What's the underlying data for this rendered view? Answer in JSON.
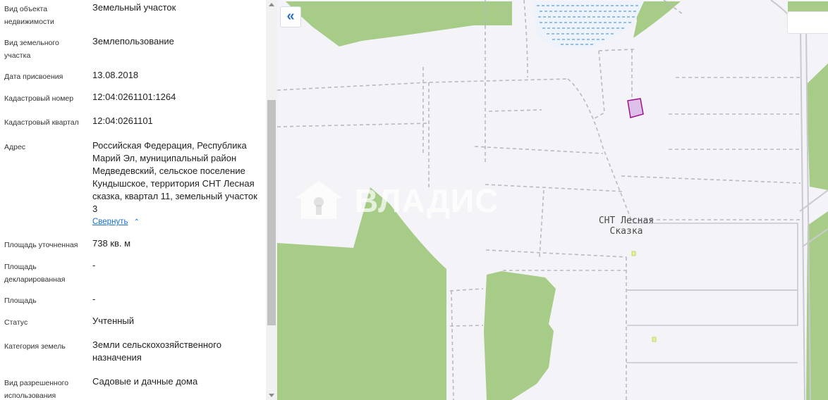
{
  "details": [
    {
      "label": "Вид объекта недвижимости",
      "value": "Земельный участок"
    },
    {
      "label": "Вид земельного участка",
      "value": "Землепользование"
    },
    {
      "label": "Дата присвоения",
      "value": "13.08.2018"
    },
    {
      "label": "Кадастровый номер",
      "value": "12:04:0261101:1264"
    },
    {
      "label": "Кадастровый квартал",
      "value": "12:04:0261101"
    },
    {
      "label": "Адрес",
      "value": "Российская Федерация, Республика Марий Эл, муниципальный район Медведевский, сельское поселение Кундышское, территория СНТ Лесная сказка, квартал 11, земельный участок 3"
    },
    {
      "label": "Площадь уточненная",
      "value": "738 кв. м"
    },
    {
      "label": "Площадь декларированная",
      "value": "-"
    },
    {
      "label": "Площадь",
      "value": "-"
    },
    {
      "label": "Статус",
      "value": "Учтенный"
    },
    {
      "label": "Категория земель",
      "value": "Земли сельскохозяйственного назначения"
    },
    {
      "label": "Вид разрешенного использования",
      "value": "Садовые и дачные дома"
    }
  ],
  "address_collapse_label": "Свернуть",
  "map": {
    "collapse_button_label": "«",
    "settlement_label_line1": "СНТ Лесная",
    "settlement_label_line2": "Сказка",
    "watermark_text": "ВЛАДИС"
  }
}
